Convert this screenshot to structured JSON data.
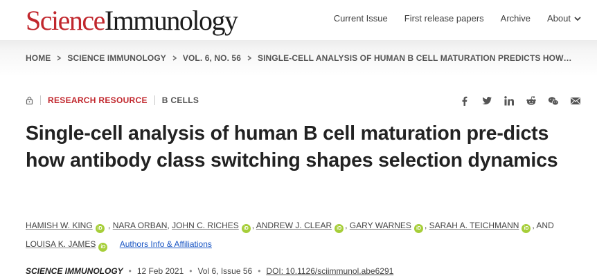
{
  "header": {
    "logo_science": "Science",
    "logo_immunology": "Immunology",
    "nav": [
      {
        "label": "Current Issue"
      },
      {
        "label": "First release papers"
      },
      {
        "label": "Archive"
      },
      {
        "label": "About"
      }
    ]
  },
  "breadcrumb": [
    {
      "label": "HOME"
    },
    {
      "label": "SCIENCE IMMUNOLOGY"
    },
    {
      "label": "VOL. 6, NO. 56"
    },
    {
      "label": "SINGLE-CELL ANALYSIS OF HUMAN B CELL MATURATION PREDICTS HOW…"
    }
  ],
  "article": {
    "type": "RESEARCH RESOURCE",
    "subject": "B CELLS",
    "title": "Single-cell analysis of human B cell maturation pre-dicts how antibody class switching shapes selection dynamics",
    "authors": [
      {
        "name": "HAMISH W. KING",
        "sep": ","
      },
      {
        "name": "NARA ORBAN",
        "sep": ","
      },
      {
        "name": "JOHN C. RICHES",
        "sep": ","
      },
      {
        "name": "ANDREW J. CLEAR",
        "sep": ","
      },
      {
        "name": "GARY WARNES",
        "sep": ","
      },
      {
        "name": "SARAH A. TEICHMANN",
        "sep": ", AND"
      },
      {
        "name": "LOUISA K. JAMES",
        "sep": ""
      }
    ],
    "authors_link": "Authors Info & Affiliations",
    "journal": "SCIENCE IMMUNOLOGY",
    "date": "12 Feb 2021",
    "volume": "Vol 6, Issue 56",
    "doi": "DOI: 10.1126/sciimmunol.abe6291"
  },
  "share": [
    {
      "icon": "facebook-icon"
    },
    {
      "icon": "twitter-icon"
    },
    {
      "icon": "linkedin-icon"
    },
    {
      "icon": "reddit-icon"
    },
    {
      "icon": "wechat-icon"
    },
    {
      "icon": "email-icon"
    }
  ],
  "colors": {
    "brand_red": "#c1272d",
    "link_blue": "#1a56c4",
    "orcid_green": "#a6ce39"
  }
}
